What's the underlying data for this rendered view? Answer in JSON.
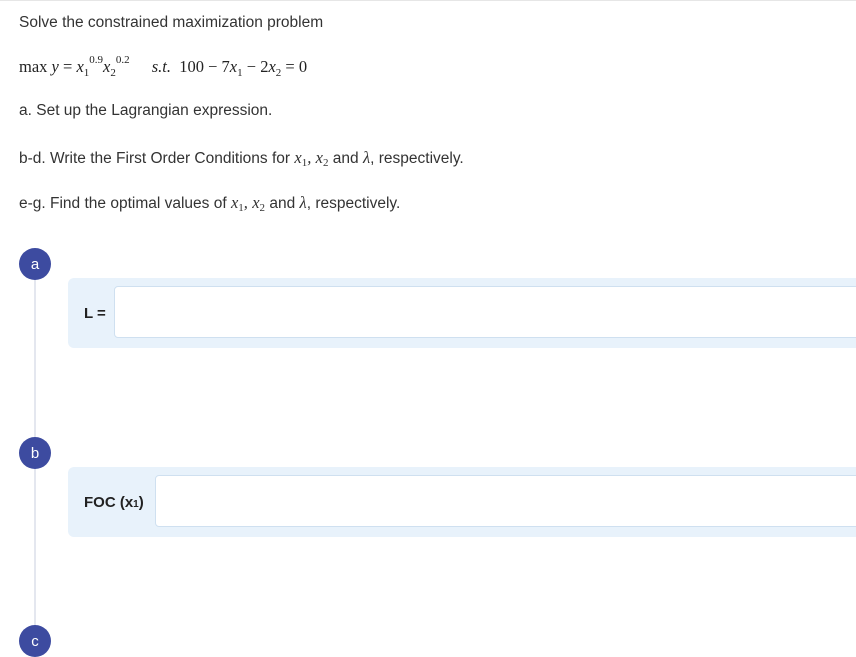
{
  "problem": {
    "intro": "Solve the constrained maximization problem",
    "objective": {
      "max": "max",
      "y": "y",
      "eq": "=",
      "x": "x",
      "exp1": "0.9",
      "exp2": "0.2",
      "sub1": "1",
      "sub2": "2"
    },
    "constraint": {
      "st": "s.t.",
      "c100": "100",
      "minus": "−",
      "coef1": "7",
      "coef2": "2",
      "rhs": "= 0"
    }
  },
  "questions": {
    "a": "a. Set up the Lagrangian expression.",
    "bd_prefix": "b-d. Write the First Order Conditions for ",
    "eg_prefix": "e-g. Find the optimal values of ",
    "comma": ",",
    "and": "and",
    "lambda": "λ",
    "suffix": ", respectively.",
    "x": "x",
    "one": "1",
    "two": "2"
  },
  "steps": {
    "a": {
      "badge": "a",
      "label": "L =",
      "input_value": ""
    },
    "b": {
      "badge": "b",
      "label_main": "FOC (x",
      "label_sub": "1",
      "label_end": ")",
      "input_value": ""
    },
    "c": {
      "badge": "c"
    }
  },
  "colors": {
    "badge": "#3d4ba0",
    "panel_bg": "#e8f2fb",
    "input_border": "#cfe0f0",
    "text": "#333333"
  }
}
